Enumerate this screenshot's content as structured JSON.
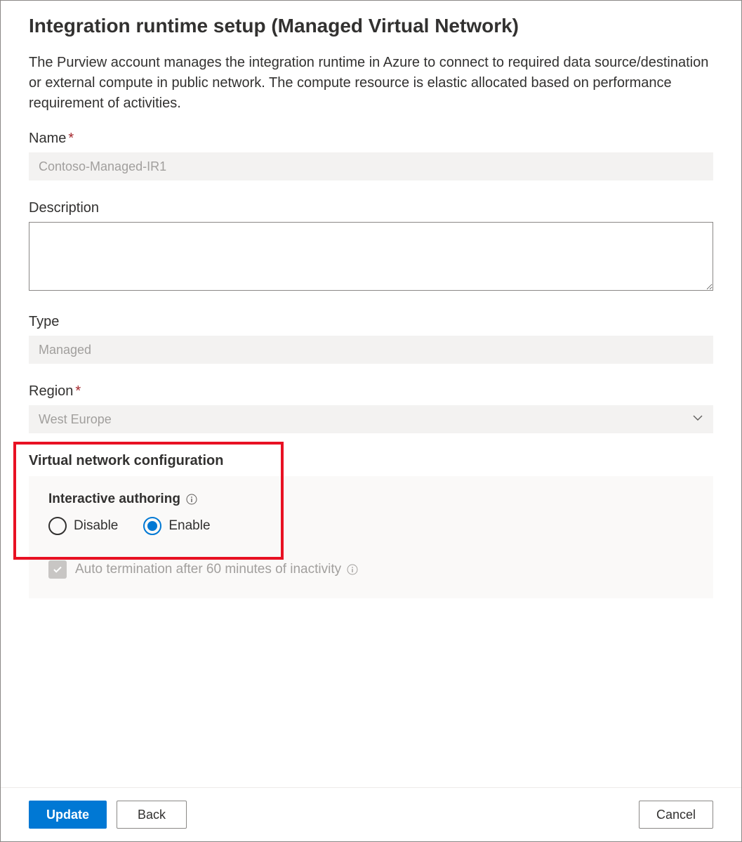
{
  "header": {
    "title": "Integration runtime setup (Managed Virtual Network)"
  },
  "intro": "The Purview account manages the integration runtime in Azure to connect to required data source/destination or external compute in public network. The compute resource is elastic allocated based on performance requirement of activities.",
  "fields": {
    "name": {
      "label": "Name",
      "required": "*",
      "value": "Contoso-Managed-IR1"
    },
    "description": {
      "label": "Description",
      "value": ""
    },
    "type": {
      "label": "Type",
      "value": "Managed"
    },
    "region": {
      "label": "Region",
      "required": "*",
      "value": "West Europe"
    }
  },
  "vnet": {
    "section_title": "Virtual network configuration",
    "interactive_authoring": {
      "label": "Interactive authoring",
      "options": {
        "disable": "Disable",
        "enable": "Enable"
      },
      "selected": "enable"
    },
    "auto_termination": {
      "label": "Auto termination after 60 minutes of inactivity",
      "checked": true,
      "disabled": true
    }
  },
  "footer": {
    "update": "Update",
    "back": "Back",
    "cancel": "Cancel"
  }
}
